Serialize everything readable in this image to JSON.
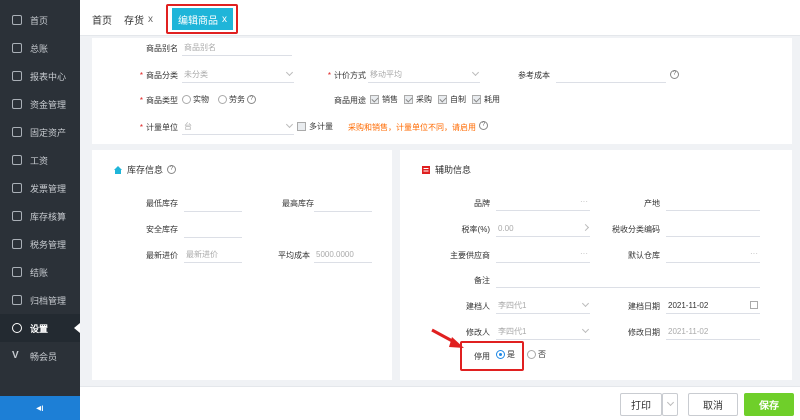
{
  "sidebar": {
    "items": [
      {
        "label": "首页",
        "icon": "home-icon"
      },
      {
        "label": "总账",
        "icon": "ledger-icon"
      },
      {
        "label": "报表中心",
        "icon": "chart-icon"
      },
      {
        "label": "资金管理",
        "icon": "money-icon"
      },
      {
        "label": "固定资产",
        "icon": "asset-icon"
      },
      {
        "label": "工资",
        "icon": "salary-icon"
      },
      {
        "label": "发票管理",
        "icon": "invoice-icon"
      },
      {
        "label": "库存核算",
        "icon": "warehouse-icon"
      },
      {
        "label": "税务管理",
        "icon": "tax-icon"
      },
      {
        "label": "结账",
        "icon": "checkout-icon"
      },
      {
        "label": "归档管理",
        "icon": "archive-icon"
      },
      {
        "label": "设置",
        "icon": "gear-icon"
      },
      {
        "label": "畅会员",
        "icon": "vip-icon"
      }
    ],
    "active_index": 11,
    "collapse_glyph": "◂ı"
  },
  "tabs": [
    {
      "label": "首页",
      "closable": false
    },
    {
      "label": "存货",
      "close": "x"
    },
    {
      "label": "编辑商品",
      "close": "x",
      "active": true
    }
  ],
  "basic": {
    "alias_label": "商品别名",
    "alias_placeholder": "商品别名",
    "category_label": "商品分类",
    "category_placeholder": "未分类",
    "pricing_label": "计价方式",
    "pricing_placeholder": "移动平均",
    "ref_cost_label": "参考成本",
    "type_label": "商品类型",
    "type_options": [
      "实物",
      "劳务"
    ],
    "usage_label": "商品用途",
    "usage_options": [
      "销售",
      "采购",
      "自制",
      "耗用"
    ],
    "unit_label": "计量单位",
    "unit_placeholder": "台",
    "multi_unit_label": "多计量",
    "unit_hint": "采购和销售，计量单位不同，请启用"
  },
  "inventory": {
    "title": "库存信息",
    "min_stock_label": "最低库存",
    "max_stock_label": "最高库存",
    "safe_stock_label": "安全库存",
    "last_price_label": "最新进价",
    "last_price_placeholder": "最新进价",
    "avg_cost_label": "平均成本",
    "avg_cost_placeholder": "5000.0000"
  },
  "aux": {
    "title": "辅助信息",
    "brand_label": "品牌",
    "origin_label": "产地",
    "tax_rate_label": "税率(%)",
    "tax_rate_placeholder": "0.00",
    "tax_code_label": "税收分类编码",
    "supplier_label": "主要供应商",
    "default_wh_label": "默认仓库",
    "note_label": "备注",
    "creator_label": "建档人",
    "creator_value": "李四代1",
    "create_date_label": "建档日期",
    "create_date_value": "2021-11-02",
    "modifier_label": "修改人",
    "modifier_value": "李四代1",
    "modify_date_label": "修改日期",
    "modify_date_value": "2021-11-02",
    "disabled_label": "停用",
    "disabled_yes": "是",
    "disabled_no": "否",
    "disabled_selected": "是"
  },
  "footer": {
    "print_label": "打印",
    "cancel_label": "取消",
    "save_label": "保存"
  },
  "colors": {
    "sidebar_bg": "#2b3138",
    "tab_active": "#1fb5d9",
    "annotation_red": "#e02020",
    "save_green": "#6fcf2a",
    "radio_blue": "#1e88e5"
  }
}
